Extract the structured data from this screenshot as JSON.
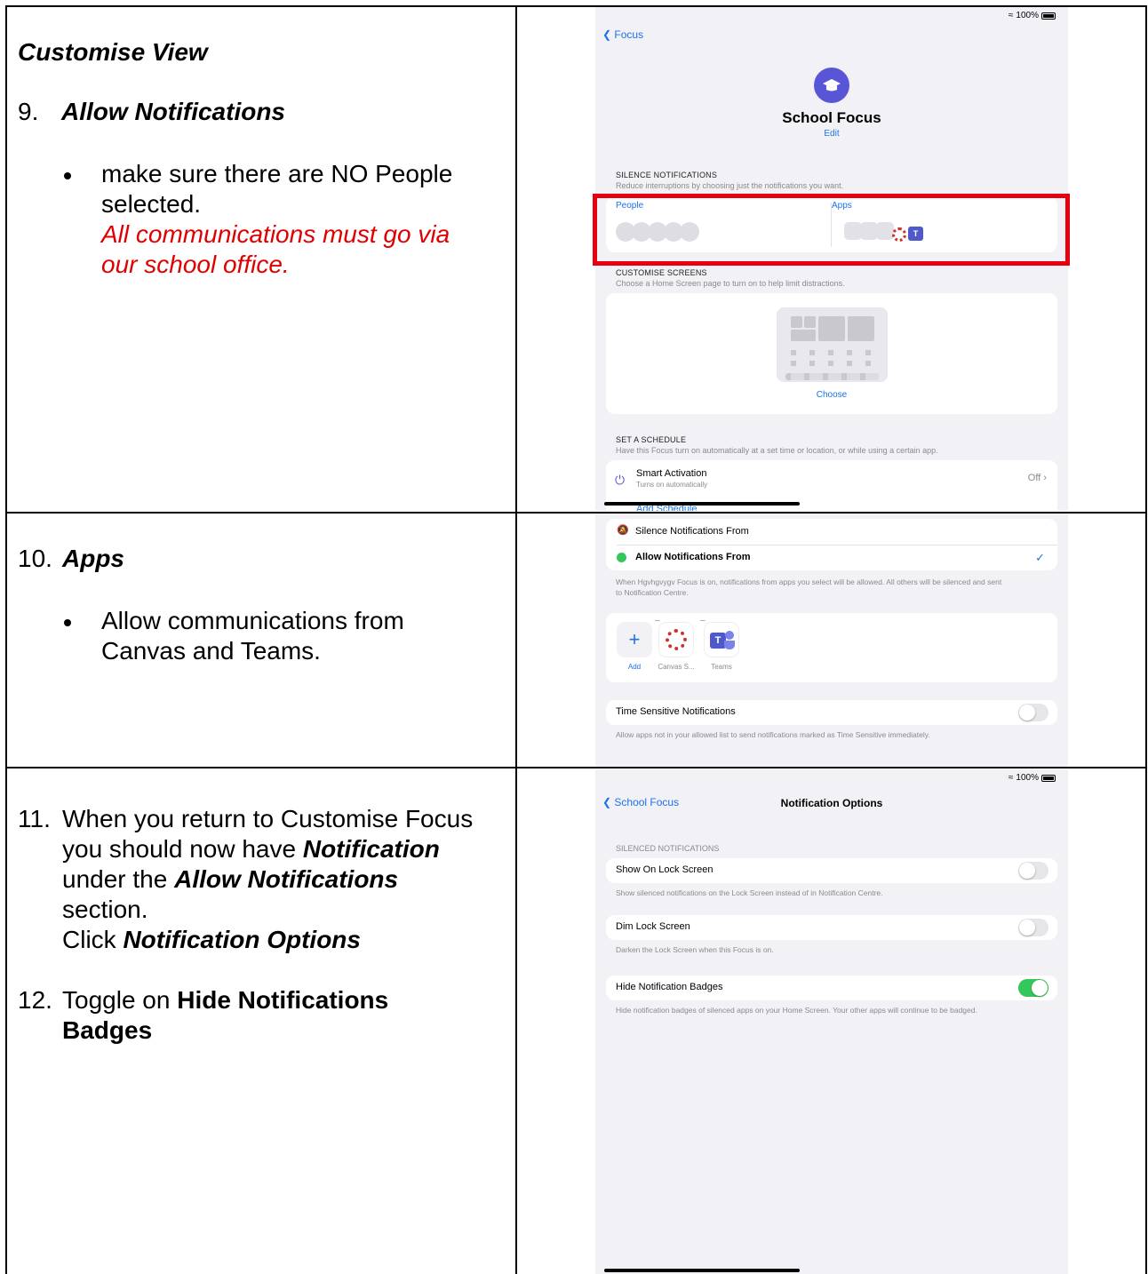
{
  "row1": {
    "heading": "Customise View",
    "step_number": "9.",
    "step_title": "Allow Notifications",
    "bullet_line1": "make sure there are NO People",
    "bullet_line2": "selected.",
    "red_line1": "All communications must go via",
    "red_line2": "our school office."
  },
  "row2": {
    "step_number": "10.",
    "step_title": "Apps",
    "bullet_line1": "Allow communications from",
    "bullet_line2": "Canvas and Teams."
  },
  "row3": {
    "step11_number": "11.",
    "step11_line1": "When you return to Customise Focus",
    "step11_line2a": "you should now have ",
    "step11_line2b": "Notification",
    "step11_line3a": "under the ",
    "step11_line3b": "Allow Notifications",
    "step11_line4": "section.",
    "step11_line5a": "Click ",
    "step11_line5b": "Notification Options",
    "step12_number": "12.",
    "step12_line1a": "Toggle on ",
    "step12_line1b": "Hide Notifications",
    "step12_line2": "Badges"
  },
  "shot1": {
    "battery": "100%",
    "back": "Focus",
    "title": "School Focus",
    "edit": "Edit",
    "silence_header": "SILENCE NOTIFICATIONS",
    "silence_sub": "Reduce interruptions by choosing just the notifications you want.",
    "people": "People",
    "apps": "Apps",
    "screens_header": "CUSTOMISE SCREENS",
    "screens_sub": "Choose a Home Screen page to turn on to help limit distractions.",
    "choose": "Choose",
    "schedule_header": "SET A SCHEDULE",
    "schedule_sub": "Have this Focus turn on automatically at a set time or location, or while using a certain app.",
    "smart_title": "Smart Activation",
    "smart_sub": "Turns on automatically",
    "smart_value": "Off",
    "add_schedule": "Add Schedule"
  },
  "shot2": {
    "silence_from": "Silence Notifications From",
    "allow_from": "Allow Notifications From",
    "note_line1": "When Hgvhgvygv Focus is on, notifications from apps you select will be allowed. All others will be silenced and sent",
    "note_line2": "to Notification Centre.",
    "add": "Add",
    "canvas": "Canvas S...",
    "teams": "Teams",
    "time_sensitive": "Time Sensitive Notifications",
    "time_sensitive_note": "Allow apps not in your allowed list to send notifications marked as Time Sensitive immediately."
  },
  "shot3": {
    "battery": "100%",
    "back": "School Focus",
    "title": "Notification Options",
    "silenced_header": "SILENCED NOTIFICATIONS",
    "lock_screen": "Show On Lock Screen",
    "lock_screen_note": "Show silenced notifications on the Lock Screen instead of in Notification Centre.",
    "dim": "Dim Lock Screen",
    "dim_note": "Darken the Lock Screen when this Focus is on.",
    "badges": "Hide Notification Badges",
    "badges_note": "Hide notification badges of silenced apps on your Home Screen. Your other apps will continue to be badged."
  },
  "colors": {
    "red": "#e00000",
    "ios_blue": "#1a73e8",
    "focus_purple": "#5856d6",
    "toggle_on": "#34c759"
  }
}
